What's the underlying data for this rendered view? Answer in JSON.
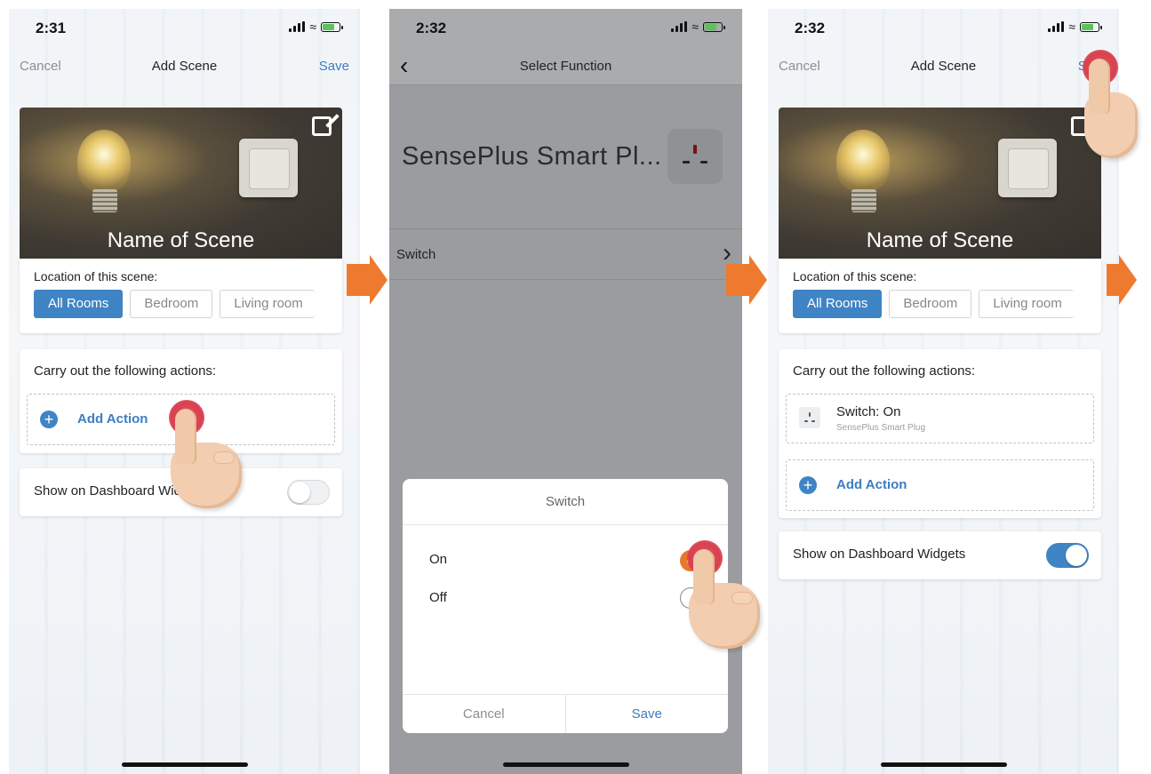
{
  "screens": [
    {
      "status": {
        "time": "2:31"
      },
      "nav": {
        "left": "Cancel",
        "title": "Add Scene",
        "right": "Save"
      },
      "scene_name": "Name of Scene",
      "location": {
        "label": "Location of this scene:",
        "rooms": [
          "All Rooms",
          "Bedroom",
          "Living room"
        ],
        "selected": "All Rooms"
      },
      "actions": {
        "title": "Carry out the following actions:",
        "add_label": "Add Action"
      },
      "dashboard": {
        "label": "Show on Dashboard Widgets",
        "enabled": false
      }
    },
    {
      "status": {
        "time": "2:32"
      },
      "nav": {
        "title": "Select Function"
      },
      "device_name": "SensePlus Smart Pl...",
      "function_row": "Switch",
      "dialog": {
        "title": "Switch",
        "options": [
          {
            "label": "On",
            "checked": true
          },
          {
            "label": "Off",
            "checked": false
          }
        ],
        "cancel": "Cancel",
        "save": "Save"
      }
    },
    {
      "status": {
        "time": "2:32"
      },
      "nav": {
        "left": "Cancel",
        "title": "Add Scene",
        "right": "Save"
      },
      "scene_name": "Name of Scene",
      "location": {
        "label": "Location of this scene:",
        "rooms": [
          "All Rooms",
          "Bedroom",
          "Living room"
        ],
        "selected": "All Rooms"
      },
      "actions": {
        "title": "Carry out the following actions:",
        "items": [
          {
            "title": "Switch: On",
            "subtitle": "SensePlus Smart Plug"
          }
        ],
        "add_label": "Add Action"
      },
      "dashboard": {
        "label": "Show on Dashboard Widgets",
        "enabled": true
      }
    }
  ],
  "colors": {
    "accent": "#3f84c5",
    "arrow": "#ee7a2f",
    "check": "#e8762c",
    "tap_dot": "#d8414f",
    "battery": "#5cc35c"
  },
  "icons": [
    "signal-icon",
    "wifi-icon",
    "battery-icon",
    "edit-icon",
    "plus-icon",
    "plug-icon",
    "chevron-right-icon",
    "back-chevron-icon",
    "check-icon",
    "step-arrow-icon",
    "tap-hand-icon"
  ]
}
